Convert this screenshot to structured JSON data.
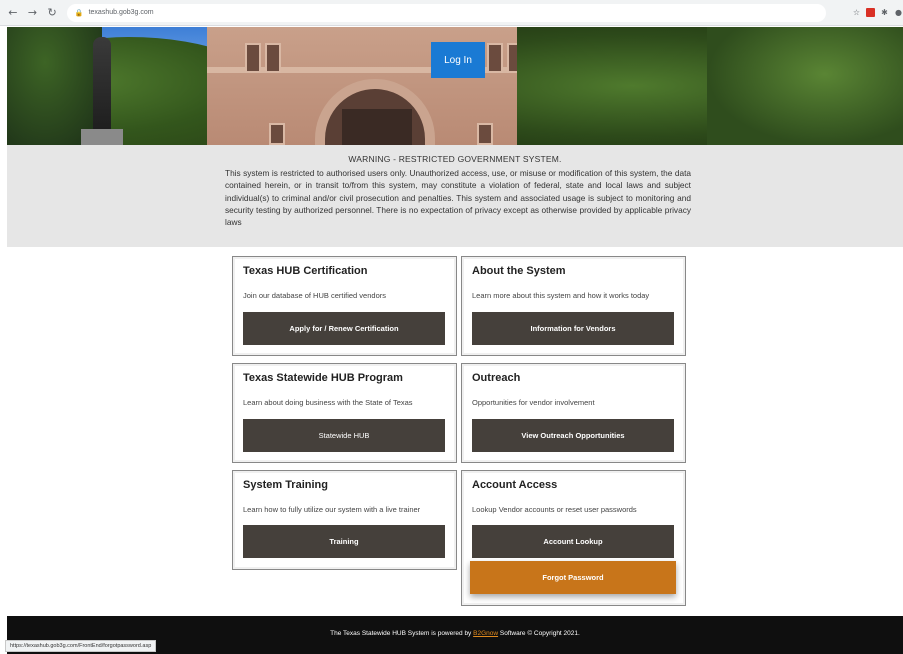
{
  "browser": {
    "url": "texashub.gob3g.com",
    "status_url": "https://texashub.gob3g.com/FrontEnd/forgotpassword.asp"
  },
  "header": {
    "login_label": "Log In"
  },
  "warning": {
    "title": "WARNING - RESTRICTED GOVERNMENT SYSTEM.",
    "body": "This system is restricted to authorised users only. Unauthorized access, use, or misuse or modification of this system, the data contained herein, or in transit to/from this system, may constitute a violation of federal, state and local laws and subject individual(s) to criminal and/or civil prosecution and penalties. This system and associated usage is subject to monitoring and security testing by authorized personnel. There is no expectation of privacy except as otherwise provided by applicable privacy laws"
  },
  "cards": [
    {
      "title": "Texas HUB Certification",
      "desc": "Join our database of HUB certified vendors",
      "button": "Apply for / Renew Certification"
    },
    {
      "title": "About the System",
      "desc": "Learn more about this system and how it works today",
      "button": "Information for Vendors"
    },
    {
      "title": "Texas Statewide HUB Program",
      "desc": "Learn about doing business with the State of Texas",
      "button": "Statewide HUB"
    },
    {
      "title": "Outreach",
      "desc": "Opportunities for vendor involvement",
      "button": "View Outreach Opportunities"
    },
    {
      "title": "System Training",
      "desc": "Learn how to fully utilize our system with a live trainer",
      "button": "Training"
    },
    {
      "title": "Account Access",
      "desc": "Lookup Vendor accounts or reset user passwords",
      "button": "Account Lookup"
    }
  ],
  "forgot_password_label": "Forgot Password",
  "footer": {
    "text_before": "The Texas Statewide HUB System is powered by ",
    "brand": "B2Gnow",
    "text_after": " Software © Copyright 2021."
  },
  "colors": {
    "login_blue": "#1a7ad4",
    "card_button": "#45403b",
    "forgot_orange": "#c8751a",
    "footer_bg": "#0f0f0f",
    "warning_bg": "#e6e6e6"
  }
}
